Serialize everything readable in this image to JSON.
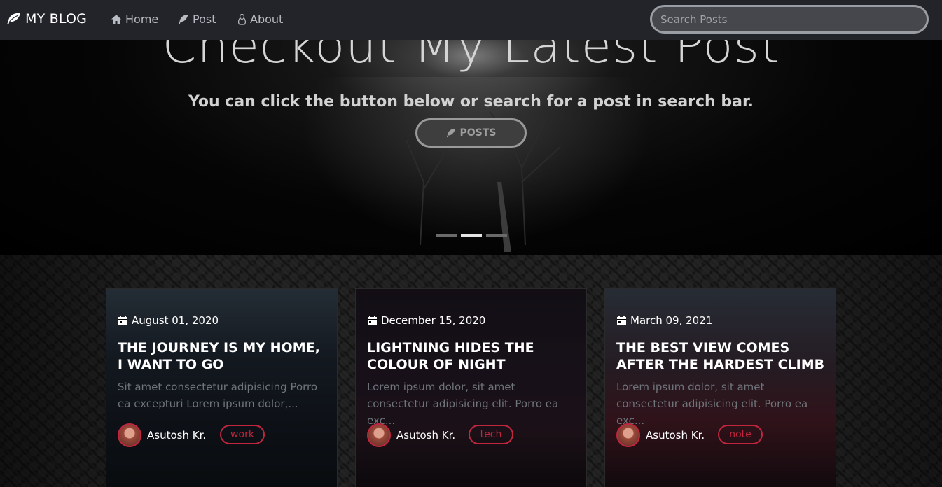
{
  "navbar": {
    "brand": "MY BLOG",
    "links": [
      {
        "label": "Home",
        "icon": "home-icon"
      },
      {
        "label": "Post",
        "icon": "feather-icon"
      },
      {
        "label": "About",
        "icon": "linux-icon"
      }
    ],
    "search_placeholder": "Search Posts"
  },
  "hero": {
    "title": "Checkout My Latest Post",
    "subtitle": "You can click the button below or search for a post in search bar.",
    "button_label": "POSTS",
    "slides": 3,
    "active_slide": 2
  },
  "posts": [
    {
      "date": "August 01, 2020",
      "title": "THE JOURNEY IS MY HOME, I WANT TO GO",
      "excerpt": "Sit amet consectetur adipisicing Porro ea excepturi Lorem ipsum dolor,...",
      "author": "Asutosh Kr.",
      "tag": "work"
    },
    {
      "date": "December 15, 2020",
      "title": "LIGHTNING HIDES THE COLOUR OF NIGHT",
      "excerpt": "Lorem ipsum dolor, sit amet consectetur adipisicing elit. Porro ea exc...",
      "author": "Asutosh Kr.",
      "tag": "tech"
    },
    {
      "date": "March 09, 2021",
      "title": "THE BEST VIEW COMES AFTER THE HARDEST CLIMB",
      "excerpt": "Lorem ipsum dolor, sit amet consectetur adipisicing elit. Porro ea exc...",
      "author": "Asutosh Kr.",
      "tag": "note"
    }
  ],
  "colors": {
    "navbar_bg": "#22242a",
    "accent": "#c2253e",
    "muted_text": "#6f747a"
  }
}
